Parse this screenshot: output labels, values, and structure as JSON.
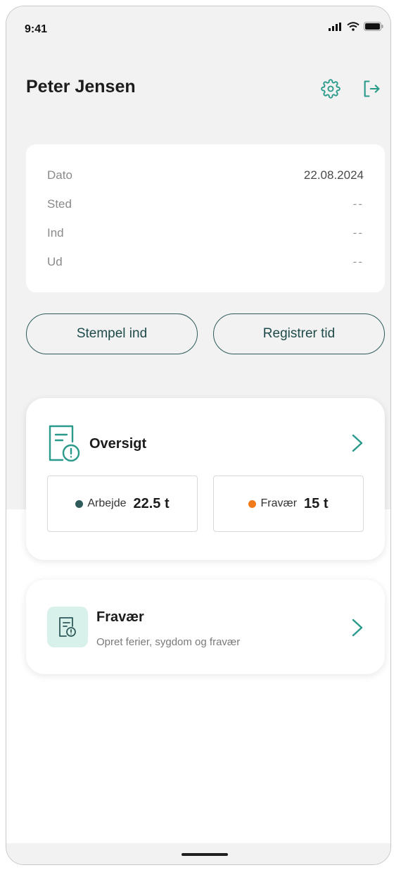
{
  "status_bar": {
    "time": "9:41"
  },
  "header": {
    "user_name": "Peter Jensen"
  },
  "info": {
    "rows": [
      {
        "label": "Dato",
        "value": "22.08.2024"
      },
      {
        "label": "Sted",
        "value": "--"
      },
      {
        "label": "Ind",
        "value": "--"
      },
      {
        "label": "Ud",
        "value": "--"
      }
    ]
  },
  "actions": {
    "clock_in_label": "Stempel ind",
    "register_time_label": "Registrer tid"
  },
  "overview": {
    "title": "Oversigt",
    "work": {
      "label": "Arbejde",
      "value": "22.5 t",
      "color": "#2f5a5a"
    },
    "absence": {
      "label": "Fravær",
      "value": "15 t",
      "color": "#f07a1a"
    }
  },
  "absence_card": {
    "title": "Fravær",
    "subtitle": "Opret ferier, sygdom og fravær"
  },
  "colors": {
    "accent": "#2a9a8a",
    "dark_teal": "#2f5a5a",
    "orange": "#f07a1a"
  }
}
